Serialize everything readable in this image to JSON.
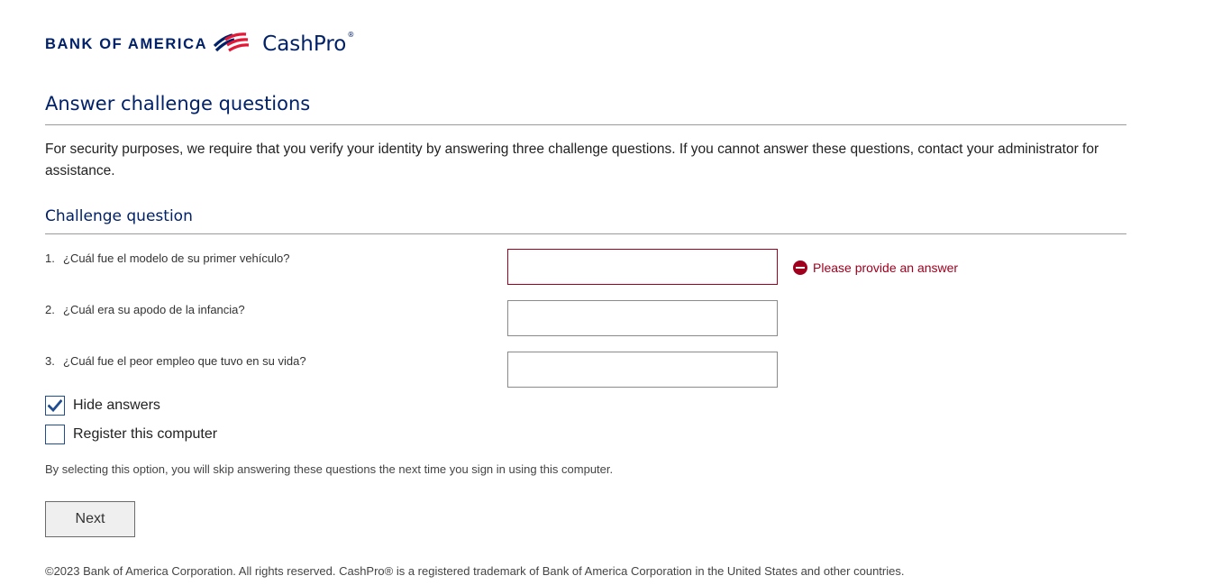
{
  "brand": {
    "bank_name": "BANK OF AMERICA",
    "product": "CashPro",
    "product_mark": "®",
    "primary_color": "#012169",
    "flag_red": "#e31837",
    "flag_blue": "#012169"
  },
  "page": {
    "title": "Answer challenge questions",
    "intro": "For security purposes, we require that you verify your identity by answering three challenge questions. If you cannot answer these questions, contact your administrator for assistance."
  },
  "challenge": {
    "section_title": "Challenge question",
    "questions": [
      {
        "number": "1.",
        "text": "¿Cuál fue el modelo de su primer vehículo?",
        "value": "",
        "error": "Please provide an answer"
      },
      {
        "number": "2.",
        "text": "¿Cuál era su apodo de la infancia?",
        "value": ""
      },
      {
        "number": "3.",
        "text": "¿Cuál fue el peor empleo que tuvo en su vida?",
        "value": ""
      }
    ],
    "error_color": "#a0001e"
  },
  "options": {
    "hide_answers": {
      "label": "Hide answers",
      "checked": true
    },
    "register_computer": {
      "label": "Register this computer",
      "checked": false
    },
    "register_note": "By selecting this option, you will skip answering these questions the next time you sign in using this computer."
  },
  "actions": {
    "next_label": "Next"
  },
  "footer": {
    "text": "©2023 Bank of America Corporation. All rights reserved. CashPro® is a registered trademark of Bank of America Corporation in the United States and other countries."
  },
  "icons": {
    "flag": "bank-flag-logo-icon",
    "error": "error-minus-circle-icon",
    "check": "checkmark-icon"
  }
}
